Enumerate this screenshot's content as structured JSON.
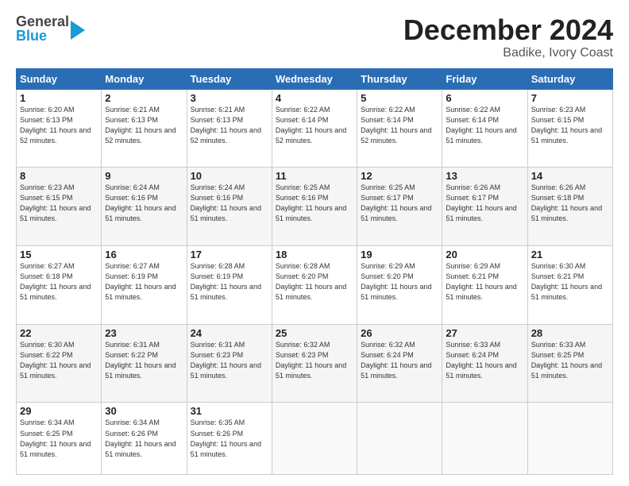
{
  "header": {
    "logo_general": "General",
    "logo_blue": "Blue",
    "title": "December 2024",
    "location": "Badike, Ivory Coast"
  },
  "days_of_week": [
    "Sunday",
    "Monday",
    "Tuesday",
    "Wednesday",
    "Thursday",
    "Friday",
    "Saturday"
  ],
  "weeks": [
    [
      {
        "day": 1,
        "info": "Sunrise: 6:20 AM\nSunset: 6:13 PM\nDaylight: 11 hours\nand 52 minutes."
      },
      {
        "day": 2,
        "info": "Sunrise: 6:21 AM\nSunset: 6:13 PM\nDaylight: 11 hours\nand 52 minutes."
      },
      {
        "day": 3,
        "info": "Sunrise: 6:21 AM\nSunset: 6:13 PM\nDaylight: 11 hours\nand 52 minutes."
      },
      {
        "day": 4,
        "info": "Sunrise: 6:22 AM\nSunset: 6:14 PM\nDaylight: 11 hours\nand 52 minutes."
      },
      {
        "day": 5,
        "info": "Sunrise: 6:22 AM\nSunset: 6:14 PM\nDaylight: 11 hours\nand 52 minutes."
      },
      {
        "day": 6,
        "info": "Sunrise: 6:22 AM\nSunset: 6:14 PM\nDaylight: 11 hours\nand 51 minutes."
      },
      {
        "day": 7,
        "info": "Sunrise: 6:23 AM\nSunset: 6:15 PM\nDaylight: 11 hours\nand 51 minutes."
      }
    ],
    [
      {
        "day": 8,
        "info": "Sunrise: 6:23 AM\nSunset: 6:15 PM\nDaylight: 11 hours\nand 51 minutes."
      },
      {
        "day": 9,
        "info": "Sunrise: 6:24 AM\nSunset: 6:16 PM\nDaylight: 11 hours\nand 51 minutes."
      },
      {
        "day": 10,
        "info": "Sunrise: 6:24 AM\nSunset: 6:16 PM\nDaylight: 11 hours\nand 51 minutes."
      },
      {
        "day": 11,
        "info": "Sunrise: 6:25 AM\nSunset: 6:16 PM\nDaylight: 11 hours\nand 51 minutes."
      },
      {
        "day": 12,
        "info": "Sunrise: 6:25 AM\nSunset: 6:17 PM\nDaylight: 11 hours\nand 51 minutes."
      },
      {
        "day": 13,
        "info": "Sunrise: 6:26 AM\nSunset: 6:17 PM\nDaylight: 11 hours\nand 51 minutes."
      },
      {
        "day": 14,
        "info": "Sunrise: 6:26 AM\nSunset: 6:18 PM\nDaylight: 11 hours\nand 51 minutes."
      }
    ],
    [
      {
        "day": 15,
        "info": "Sunrise: 6:27 AM\nSunset: 6:18 PM\nDaylight: 11 hours\nand 51 minutes."
      },
      {
        "day": 16,
        "info": "Sunrise: 6:27 AM\nSunset: 6:19 PM\nDaylight: 11 hours\nand 51 minutes."
      },
      {
        "day": 17,
        "info": "Sunrise: 6:28 AM\nSunset: 6:19 PM\nDaylight: 11 hours\nand 51 minutes."
      },
      {
        "day": 18,
        "info": "Sunrise: 6:28 AM\nSunset: 6:20 PM\nDaylight: 11 hours\nand 51 minutes."
      },
      {
        "day": 19,
        "info": "Sunrise: 6:29 AM\nSunset: 6:20 PM\nDaylight: 11 hours\nand 51 minutes."
      },
      {
        "day": 20,
        "info": "Sunrise: 6:29 AM\nSunset: 6:21 PM\nDaylight: 11 hours\nand 51 minutes."
      },
      {
        "day": 21,
        "info": "Sunrise: 6:30 AM\nSunset: 6:21 PM\nDaylight: 11 hours\nand 51 minutes."
      }
    ],
    [
      {
        "day": 22,
        "info": "Sunrise: 6:30 AM\nSunset: 6:22 PM\nDaylight: 11 hours\nand 51 minutes."
      },
      {
        "day": 23,
        "info": "Sunrise: 6:31 AM\nSunset: 6:22 PM\nDaylight: 11 hours\nand 51 minutes."
      },
      {
        "day": 24,
        "info": "Sunrise: 6:31 AM\nSunset: 6:23 PM\nDaylight: 11 hours\nand 51 minutes."
      },
      {
        "day": 25,
        "info": "Sunrise: 6:32 AM\nSunset: 6:23 PM\nDaylight: 11 hours\nand 51 minutes."
      },
      {
        "day": 26,
        "info": "Sunrise: 6:32 AM\nSunset: 6:24 PM\nDaylight: 11 hours\nand 51 minutes."
      },
      {
        "day": 27,
        "info": "Sunrise: 6:33 AM\nSunset: 6:24 PM\nDaylight: 11 hours\nand 51 minutes."
      },
      {
        "day": 28,
        "info": "Sunrise: 6:33 AM\nSunset: 6:25 PM\nDaylight: 11 hours\nand 51 minutes."
      }
    ],
    [
      {
        "day": 29,
        "info": "Sunrise: 6:34 AM\nSunset: 6:25 PM\nDaylight: 11 hours\nand 51 minutes."
      },
      {
        "day": 30,
        "info": "Sunrise: 6:34 AM\nSunset: 6:26 PM\nDaylight: 11 hours\nand 51 minutes."
      },
      {
        "day": 31,
        "info": "Sunrise: 6:35 AM\nSunset: 6:26 PM\nDaylight: 11 hours\nand 51 minutes."
      },
      {
        "day": null,
        "info": ""
      },
      {
        "day": null,
        "info": ""
      },
      {
        "day": null,
        "info": ""
      },
      {
        "day": null,
        "info": ""
      }
    ]
  ]
}
